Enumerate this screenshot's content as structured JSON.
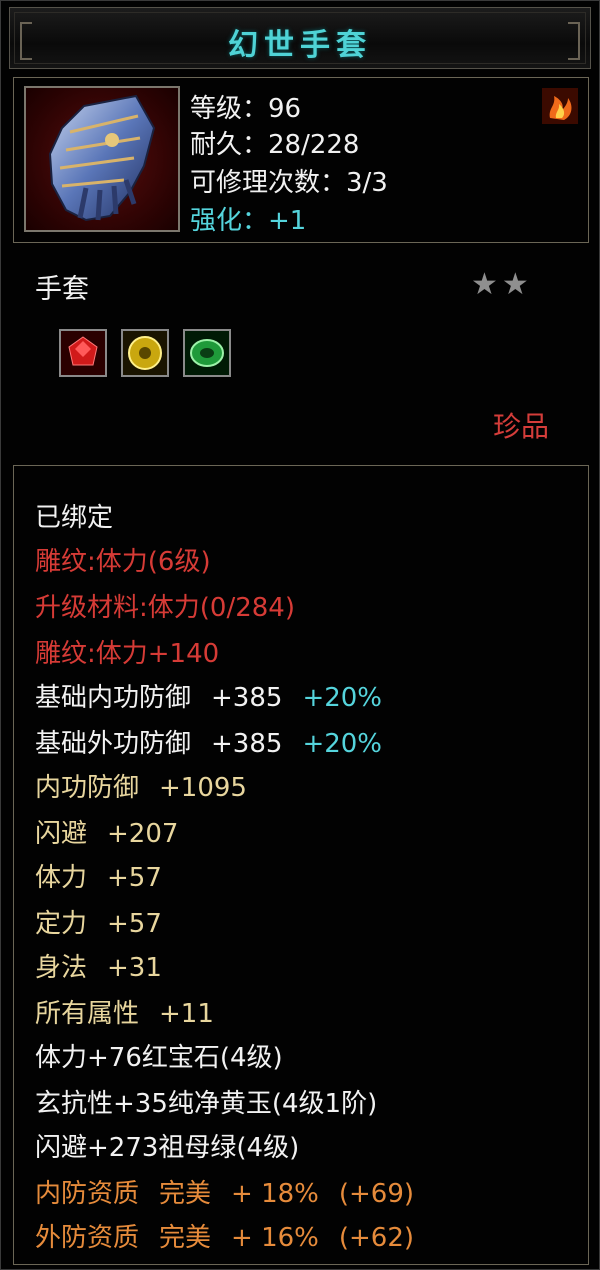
{
  "item": {
    "name": "幻世手套",
    "level_label": "等级：96",
    "durability_label": "耐久：28/228",
    "repair_label": "可修理次数：3/3",
    "enhance_label": "强化：+1",
    "type": "手套",
    "stars": "★★",
    "star_count": 2,
    "quality": "珍品"
  },
  "attributes": {
    "bound": "已绑定",
    "engrave": "雕纹:体力(6级)",
    "upgrade_material": "升级材料:体力(0/284)",
    "engrave_bonus": "雕纹:体力+140",
    "base_inner_def": {
      "label": "基础内功防御",
      "value": "+385",
      "pct": "+20%"
    },
    "base_outer_def": {
      "label": "基础外功防御",
      "value": "+385",
      "pct": "+20%"
    },
    "stats": [
      {
        "label": "内功防御",
        "value": "+1095"
      },
      {
        "label": "闪避",
        "value": "+207"
      },
      {
        "label": "体力",
        "value": "+57"
      },
      {
        "label": "定力",
        "value": "+57"
      },
      {
        "label": "身法",
        "value": "+31"
      },
      {
        "label": "所有属性",
        "value": "+11"
      }
    ],
    "gem_lines": [
      "体力+76红宝石(4级)",
      "玄抗性+35纯净黄玉(4级1阶)",
      "闪避+273祖母绿(4级)"
    ],
    "aptitudes": [
      {
        "label": "内防资质",
        "grade": "完美",
        "value": "+ 18%",
        "extra": "(+69)"
      },
      {
        "label": "外防资质",
        "grade": "完美",
        "value": "+ 16%",
        "extra": "(+62)"
      }
    ]
  },
  "icons": {
    "item_icon": "gauntlet-icon",
    "fire_icon": "flame-icon",
    "gems": [
      "ruby-gem-icon",
      "topaz-gem-icon",
      "emerald-gem-icon"
    ]
  },
  "colors": {
    "title": "#4fd3d6",
    "red": "#d63b36",
    "tan": "#e8d69e",
    "orange": "#e68b3b",
    "cyan": "#55d4dc"
  }
}
